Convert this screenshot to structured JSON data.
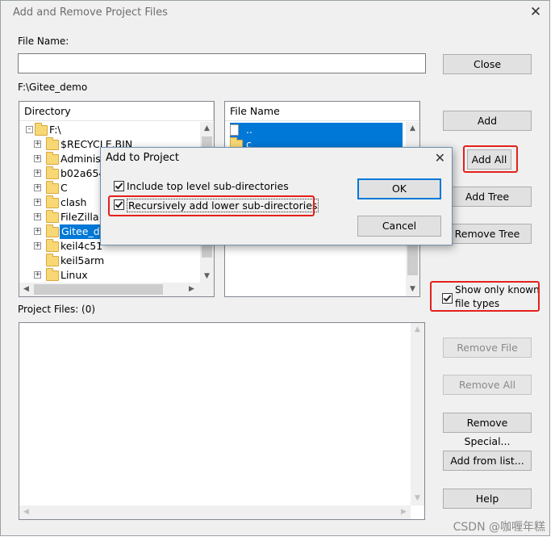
{
  "window": {
    "title": "Add and Remove Project Files",
    "close_glyph": "✕"
  },
  "file_name": {
    "label": "File Name:",
    "value": ""
  },
  "current_path": "F:\\Gitee_demo",
  "directory": {
    "header": "Directory",
    "items": [
      {
        "label": "F:\\",
        "expander": "-",
        "selected": false
      },
      {
        "label": "$RECYCLE.BIN",
        "expander": "+",
        "selected": false
      },
      {
        "label": "Administ",
        "expander": "+",
        "selected": false
      },
      {
        "label": "b02a6545",
        "expander": "+",
        "selected": false
      },
      {
        "label": "C",
        "expander": "+",
        "selected": false
      },
      {
        "label": "clash",
        "expander": "+",
        "selected": false
      },
      {
        "label": "FileZilla",
        "expander": "+",
        "selected": false
      },
      {
        "label": "Gitee_de",
        "expander": "+",
        "selected": true
      },
      {
        "label": "keil4c51",
        "expander": "+",
        "selected": false
      },
      {
        "label": "keil5arm",
        "expander": "",
        "selected": false
      },
      {
        "label": "Linux",
        "expander": "+",
        "selected": false
      }
    ]
  },
  "file_list": {
    "header": "File Name",
    "items": [
      {
        "label": "..",
        "selected": true
      },
      {
        "label": "c",
        "selected": true
      }
    ]
  },
  "buttons": {
    "close": "Close",
    "add": "Add",
    "add_all": "Add All",
    "add_tree": "Add Tree",
    "remove_tree": "Remove Tree",
    "remove_file": "Remove File",
    "remove_all": "Remove All",
    "remove_special": "Remove Special...",
    "add_from_list": "Add from list...",
    "help": "Help"
  },
  "show_known": {
    "line1": "Show only known",
    "line2": "file types",
    "checked": true
  },
  "project_files": {
    "label": "Project Files: (0)"
  },
  "dialog": {
    "title": "Add to Project",
    "close_glyph": "✕",
    "opt_top_level": "Include top level sub-directories",
    "opt_recursive": "Recursively add lower sub-directories",
    "ok": "OK",
    "cancel": "Cancel"
  },
  "background_glyph": "e",
  "watermark": "CSDN @咖喱年糕",
  "colors": {
    "highlight": "#0078d7",
    "annotation_red": "#e4211c"
  }
}
